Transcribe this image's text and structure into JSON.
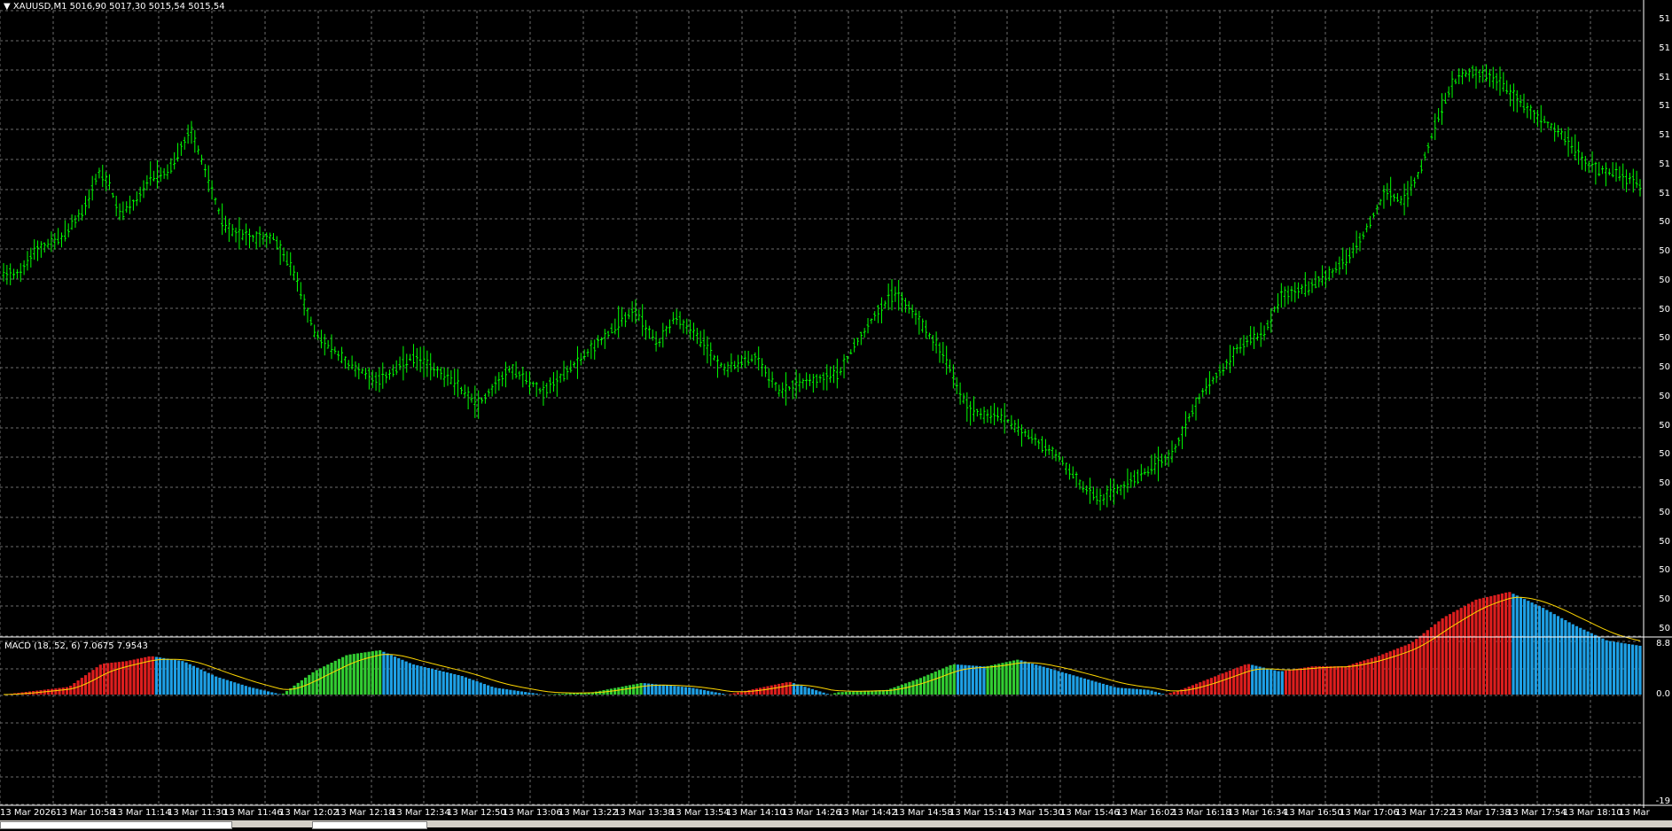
{
  "header": {
    "symbol_info": "XAUUSD,M1  5016,90 5017,30 5015,54 5015,54",
    "dropdown_icon": "triangle-down-icon"
  },
  "macd": {
    "label": "MACD (18, 52, 6)  7.0675 7.9543",
    "max_label": "8.8",
    "zero_label": "0.0",
    "min_label": "-19"
  },
  "price_axis_labels": [
    "51",
    "51",
    "51",
    "51",
    "51",
    "51",
    "51",
    "50",
    "50",
    "50",
    "50",
    "50",
    "50",
    "50",
    "50",
    "50",
    "50",
    "50",
    "50",
    "50",
    "50",
    "50"
  ],
  "time_axis_labels": [
    "13 Mar 2026",
    "13 Mar 10:58",
    "13 Mar 11:14",
    "13 Mar 11:30",
    "13 Mar 11:46",
    "13 Mar 12:02",
    "13 Mar 12:18",
    "13 Mar 12:34",
    "13 Mar 12:50",
    "13 Mar 13:06",
    "13 Mar 13:22",
    "13 Mar 13:38",
    "13 Mar 13:54",
    "13 Mar 14:10",
    "13 Mar 14:26",
    "13 Mar 14:42",
    "13 Mar 14:58",
    "13 Mar 15:14",
    "13 Mar 15:30",
    "13 Mar 15:46",
    "13 Mar 16:02",
    "13 Mar 16:18",
    "13 Mar 16:34",
    "13 Mar 16:50",
    "13 Mar 17:06",
    "13 Mar 17:22",
    "13 Mar 17:38",
    "13 Mar 17:54",
    "13 Mar 18:10",
    "13 Mar"
  ],
  "colors": {
    "background": "#000000",
    "grid": "#6b6b6b",
    "bars": "#00ff00",
    "macd_up": "#32cd32",
    "macd_blue": "#1ea0e6",
    "macd_red": "#dc1e1e",
    "signal": "#ffd700"
  },
  "chart_data": {
    "type": "line",
    "title": "XAUUSD,M1",
    "price_path_relative": [
      [
        0,
        0.585
      ],
      [
        0.01,
        0.58
      ],
      [
        0.02,
        0.62
      ],
      [
        0.035,
        0.64
      ],
      [
        0.05,
        0.69
      ],
      [
        0.058,
        0.75
      ],
      [
        0.065,
        0.73
      ],
      [
        0.07,
        0.68
      ],
      [
        0.08,
        0.7
      ],
      [
        0.09,
        0.74
      ],
      [
        0.1,
        0.75
      ],
      [
        0.115,
        0.82
      ],
      [
        0.125,
        0.74
      ],
      [
        0.135,
        0.66
      ],
      [
        0.15,
        0.64
      ],
      [
        0.165,
        0.64
      ],
      [
        0.178,
        0.58
      ],
      [
        0.19,
        0.48
      ],
      [
        0.21,
        0.43
      ],
      [
        0.23,
        0.4
      ],
      [
        0.25,
        0.44
      ],
      [
        0.27,
        0.41
      ],
      [
        0.29,
        0.36
      ],
      [
        0.31,
        0.42
      ],
      [
        0.33,
        0.38
      ],
      [
        0.35,
        0.43
      ],
      [
        0.37,
        0.48
      ],
      [
        0.385,
        0.52
      ],
      [
        0.4,
        0.46
      ],
      [
        0.41,
        0.51
      ],
      [
        0.425,
        0.47
      ],
      [
        0.44,
        0.42
      ],
      [
        0.46,
        0.44
      ],
      [
        0.475,
        0.38
      ],
      [
        0.49,
        0.4
      ],
      [
        0.51,
        0.41
      ],
      [
        0.52,
        0.46
      ],
      [
        0.535,
        0.52
      ],
      [
        0.545,
        0.55
      ],
      [
        0.56,
        0.5
      ],
      [
        0.575,
        0.44
      ],
      [
        0.59,
        0.35
      ],
      [
        0.61,
        0.34
      ],
      [
        0.62,
        0.32
      ],
      [
        0.635,
        0.29
      ],
      [
        0.645,
        0.27
      ],
      [
        0.66,
        0.22
      ],
      [
        0.67,
        0.2
      ],
      [
        0.69,
        0.23
      ],
      [
        0.7,
        0.25
      ],
      [
        0.715,
        0.28
      ],
      [
        0.73,
        0.37
      ],
      [
        0.745,
        0.42
      ],
      [
        0.755,
        0.46
      ],
      [
        0.77,
        0.48
      ],
      [
        0.78,
        0.54
      ],
      [
        0.8,
        0.56
      ],
      [
        0.82,
        0.6
      ],
      [
        0.83,
        0.64
      ],
      [
        0.845,
        0.72
      ],
      [
        0.855,
        0.7
      ],
      [
        0.865,
        0.75
      ],
      [
        0.875,
        0.83
      ],
      [
        0.885,
        0.9
      ],
      [
        0.895,
        0.92
      ],
      [
        0.91,
        0.91
      ],
      [
        0.92,
        0.89
      ],
      [
        0.93,
        0.86
      ],
      [
        0.95,
        0.82
      ],
      [
        0.97,
        0.76
      ],
      [
        0.985,
        0.75
      ],
      [
        1,
        0.73
      ]
    ],
    "macd_path_relative": [
      [
        0,
        0.45
      ],
      [
        0.04,
        0.42
      ],
      [
        0.06,
        0.33
      ],
      [
        0.075,
        0.32
      ],
      [
        0.09,
        0.3
      ],
      [
        0.11,
        0.32
      ],
      [
        0.13,
        0.38
      ],
      [
        0.15,
        0.42
      ],
      [
        0.17,
        0.45
      ],
      [
        0.19,
        0.55
      ],
      [
        0.21,
        0.62
      ],
      [
        0.23,
        0.64
      ],
      [
        0.25,
        0.58
      ],
      [
        0.28,
        0.53
      ],
      [
        0.3,
        0.48
      ],
      [
        0.33,
        0.45
      ],
      [
        0.36,
        0.46
      ],
      [
        0.39,
        0.5
      ],
      [
        0.42,
        0.48
      ],
      [
        0.45,
        0.44
      ],
      [
        0.48,
        0.4
      ],
      [
        0.51,
        0.46
      ],
      [
        0.54,
        0.47
      ],
      [
        0.56,
        0.52
      ],
      [
        0.58,
        0.58
      ],
      [
        0.6,
        0.57
      ],
      [
        0.62,
        0.6
      ],
      [
        0.64,
        0.56
      ],
      [
        0.66,
        0.52
      ],
      [
        0.68,
        0.48
      ],
      [
        0.7,
        0.47
      ],
      [
        0.72,
        0.43
      ],
      [
        0.74,
        0.38
      ],
      [
        0.76,
        0.33
      ],
      [
        0.78,
        0.36
      ],
      [
        0.8,
        0.34
      ],
      [
        0.82,
        0.34
      ],
      [
        0.84,
        0.3
      ],
      [
        0.86,
        0.25
      ],
      [
        0.88,
        0.15
      ],
      [
        0.9,
        0.08
      ],
      [
        0.92,
        0.05
      ],
      [
        0.94,
        0.11
      ],
      [
        0.96,
        0.18
      ],
      [
        0.98,
        0.24
      ],
      [
        1,
        0.26
      ]
    ]
  }
}
